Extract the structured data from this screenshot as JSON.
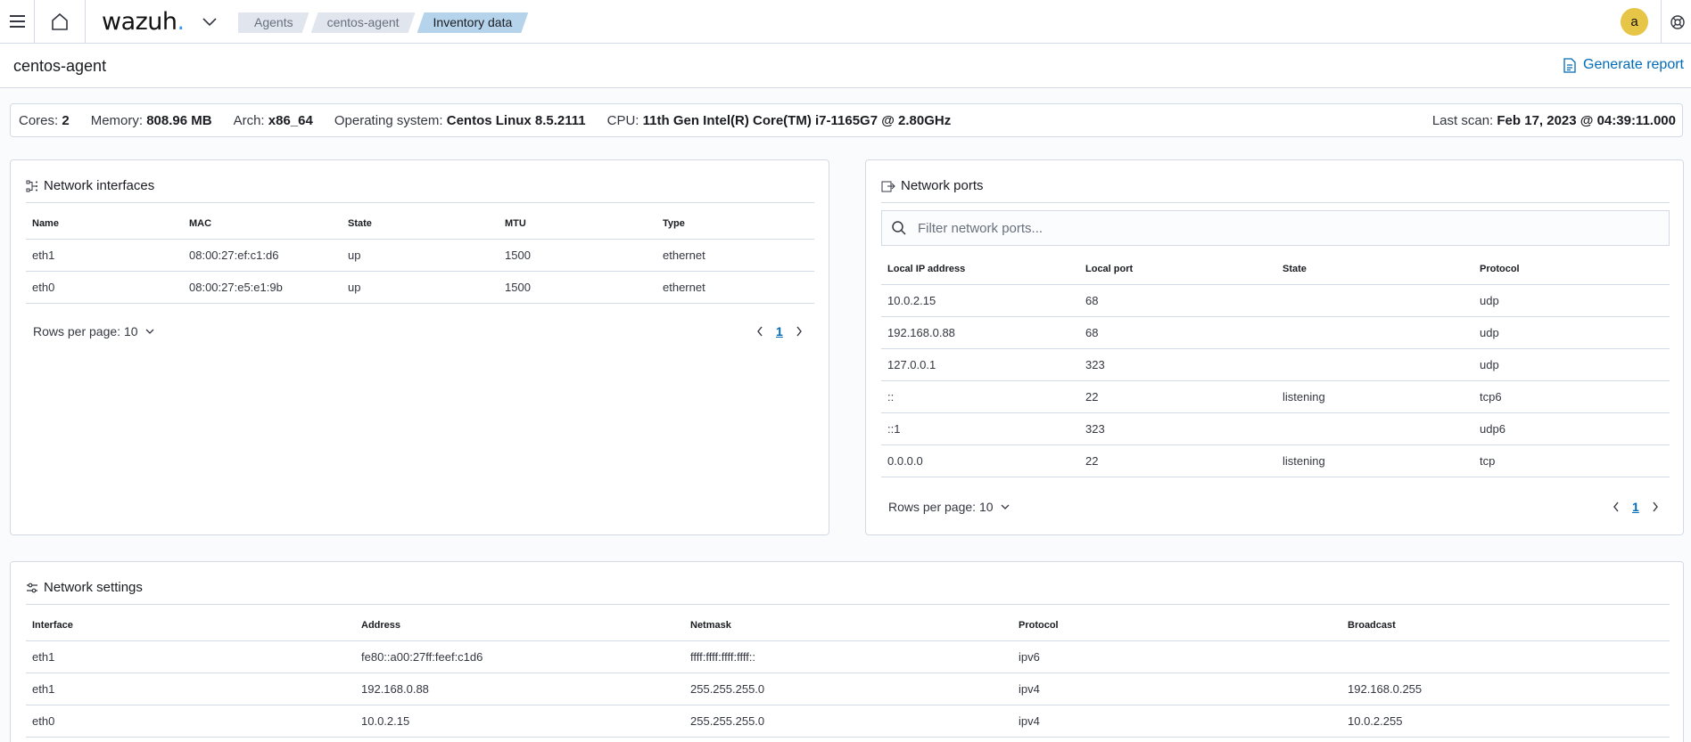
{
  "header": {
    "logo_text": "wazuh",
    "logo_dot": ".",
    "breadcrumbs": [
      "Agents",
      "centos-agent",
      "Inventory data"
    ],
    "avatar_letter": "a"
  },
  "page": {
    "title": "centos-agent",
    "generate_report_label": "Generate report"
  },
  "info": {
    "cores_label": "Cores:",
    "cores_value": "2",
    "memory_label": "Memory:",
    "memory_value": "808.96 MB",
    "arch_label": "Arch:",
    "arch_value": "x86_64",
    "os_label": "Operating system:",
    "os_value": "Centos Linux 8.5.2111",
    "cpu_label": "CPU:",
    "cpu_value": "11th Gen Intel(R) Core(TM) i7-1165G7 @ 2.80GHz",
    "last_scan_label": "Last scan:",
    "last_scan_value": "Feb 17, 2023 @ 04:39:11.000"
  },
  "network_interfaces": {
    "title": "Network interfaces",
    "columns": [
      "Name",
      "MAC",
      "State",
      "MTU",
      "Type"
    ],
    "rows": [
      [
        "eth1",
        "08:00:27:ef:c1:d6",
        "up",
        "1500",
        "ethernet"
      ],
      [
        "eth0",
        "08:00:27:e5:e1:9b",
        "up",
        "1500",
        "ethernet"
      ]
    ],
    "rows_per_page": "Rows per page: 10",
    "page": "1"
  },
  "network_ports": {
    "title": "Network ports",
    "search_placeholder": "Filter network ports...",
    "columns": [
      "Local IP address",
      "Local port",
      "State",
      "Protocol"
    ],
    "rows": [
      [
        "10.0.2.15",
        "68",
        "",
        "udp"
      ],
      [
        "192.168.0.88",
        "68",
        "",
        "udp"
      ],
      [
        "127.0.0.1",
        "323",
        "",
        "udp"
      ],
      [
        "::",
        "22",
        "listening",
        "tcp6"
      ],
      [
        "::1",
        "323",
        "",
        "udp6"
      ],
      [
        "0.0.0.0",
        "22",
        "listening",
        "tcp"
      ]
    ],
    "rows_per_page": "Rows per page: 10",
    "page": "1"
  },
  "network_settings": {
    "title": "Network settings",
    "columns": [
      "Interface",
      "Address",
      "Netmask",
      "Protocol",
      "Broadcast"
    ],
    "rows": [
      [
        "eth1",
        "fe80::a00:27ff:feef:c1d6",
        "ffff:ffff:ffff:ffff::",
        "ipv6",
        ""
      ],
      [
        "eth1",
        "192.168.0.88",
        "255.255.255.0",
        "ipv4",
        "192.168.0.255"
      ],
      [
        "eth0",
        "10.0.2.15",
        "255.255.255.0",
        "ipv4",
        "10.0.2.255"
      ]
    ]
  }
}
